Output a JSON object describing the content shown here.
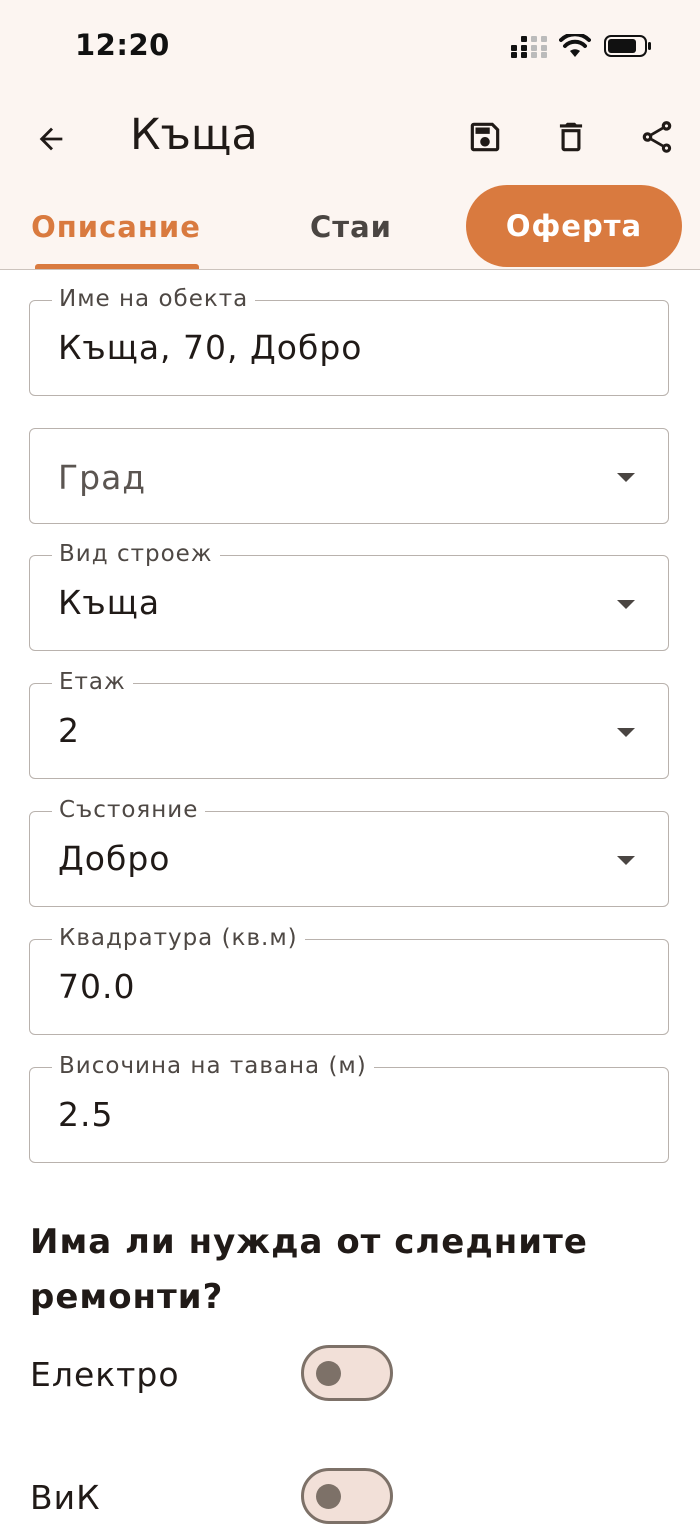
{
  "status_bar": {
    "time": "12:20",
    "icons": [
      "cellular-signal-icon",
      "wifi-icon",
      "battery-icon"
    ]
  },
  "app_bar": {
    "title": "Къща",
    "back_icon": "arrow-back-icon",
    "actions": [
      "save-icon",
      "delete-icon",
      "share-icon"
    ]
  },
  "tabs": [
    {
      "label": "Описание",
      "selected": true
    },
    {
      "label": "Стаи",
      "selected": false
    },
    {
      "label": "Оферта",
      "selected": false
    }
  ],
  "form": {
    "name": {
      "label": "Име на обекта",
      "value": "Къща, 70, Добро"
    },
    "city": {
      "placeholder": "Град"
    },
    "building_type": {
      "label": "Вид строеж",
      "value": "Къща"
    },
    "floor": {
      "label": "Етаж",
      "value": "2"
    },
    "condition": {
      "label": "Състояние",
      "value": "Добро"
    },
    "area": {
      "label": "Квадратура (кв.м)",
      "value": "70.0"
    },
    "ceiling_height": {
      "label": "Височина на тавана (м)",
      "value": "2.5"
    }
  },
  "repairs": {
    "title": "Има ли нужда от следните ремонти?",
    "items": [
      {
        "label": "Електро",
        "on": false
      },
      {
        "label": "ВиК",
        "on": false
      }
    ]
  },
  "colors": {
    "accent": "#d97a3f",
    "header_bg": "#fcf5f1",
    "switch_track": "#f2e0d8",
    "switch_border": "#7d7168"
  }
}
